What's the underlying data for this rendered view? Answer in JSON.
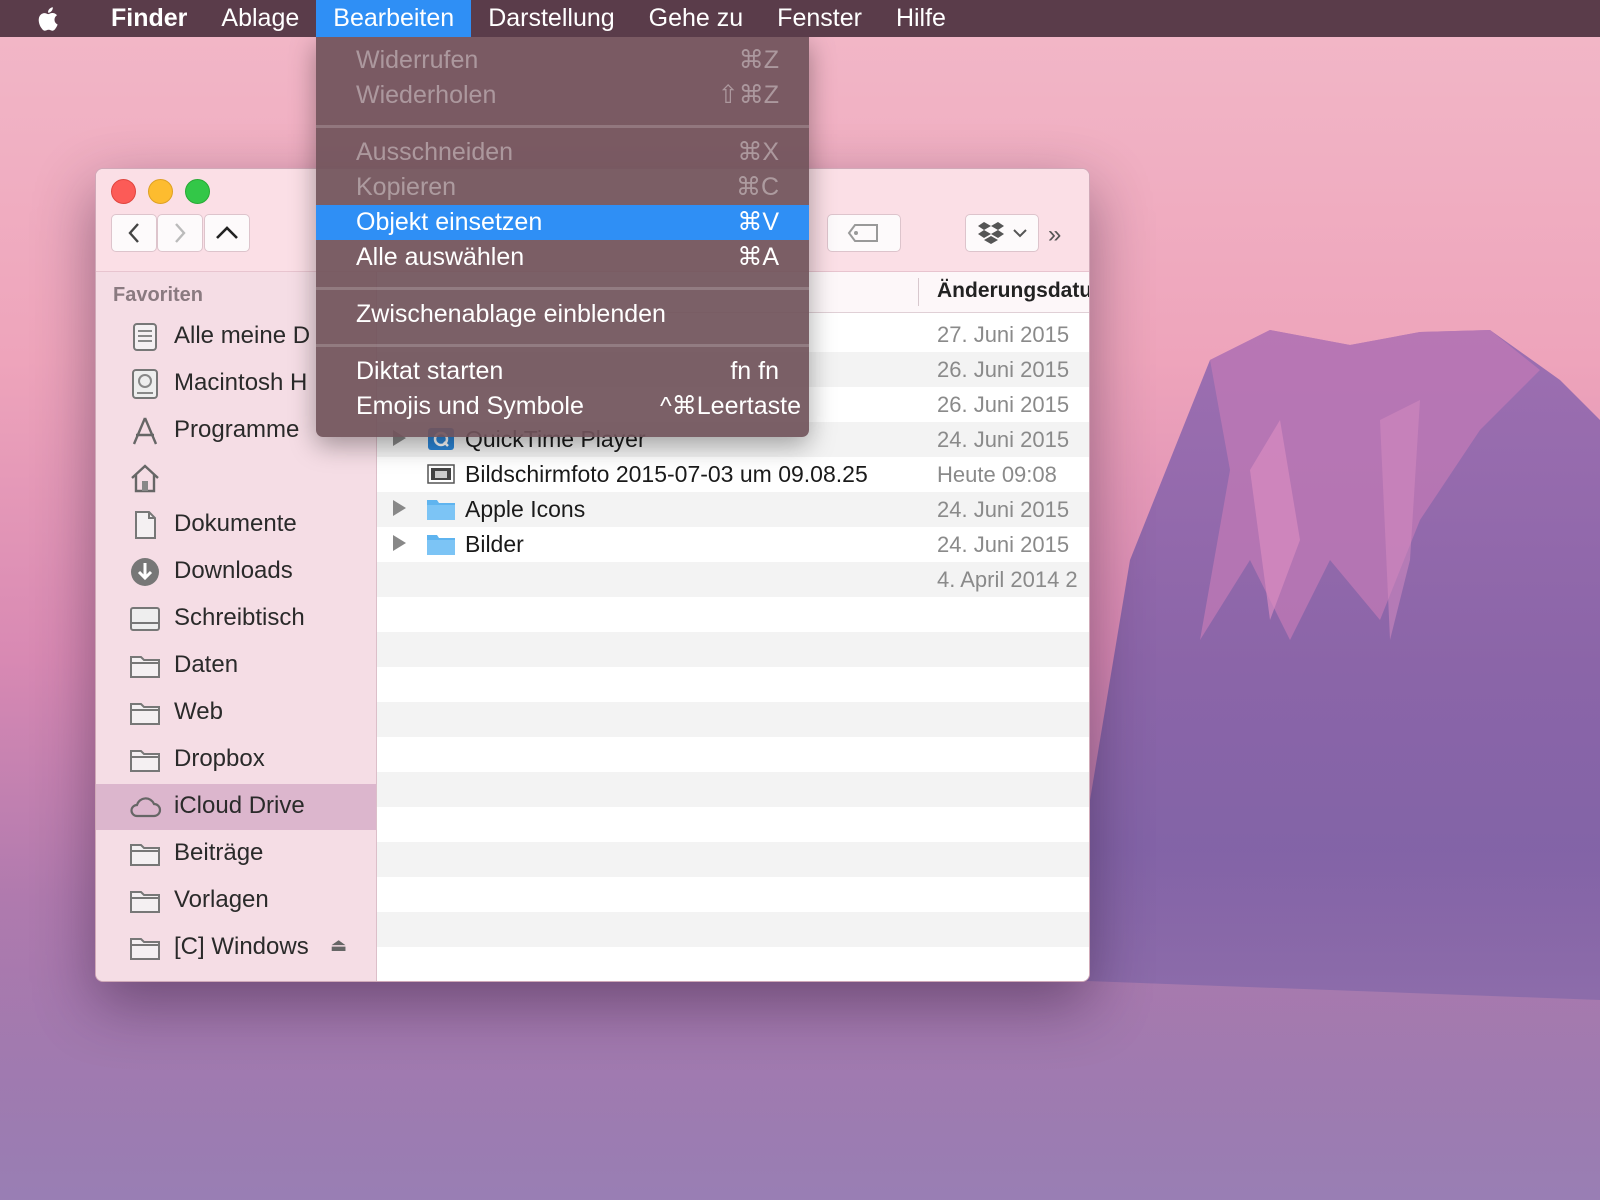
{
  "menubar": {
    "items": [
      {
        "label": "Finder"
      },
      {
        "label": "Ablage"
      },
      {
        "label": "Bearbeiten"
      },
      {
        "label": "Darstellung"
      },
      {
        "label": "Gehe zu"
      },
      {
        "label": "Fenster"
      },
      {
        "label": "Hilfe"
      }
    ],
    "active_item": "Bearbeiten"
  },
  "edit_menu": {
    "items": [
      {
        "label": "Widerrufen",
        "shortcut": "⌘Z",
        "enabled": false
      },
      {
        "label": "Wiederholen",
        "shortcut": "⇧⌘Z",
        "enabled": false
      },
      {
        "label": "Ausschneiden",
        "shortcut": "⌘X",
        "enabled": false
      },
      {
        "label": "Kopieren",
        "shortcut": "⌘C",
        "enabled": false
      },
      {
        "label": "Objekt einsetzen",
        "shortcut": "⌘V",
        "enabled": true,
        "highlighted": true
      },
      {
        "label": "Alle auswählen",
        "shortcut": "⌘A",
        "enabled": true
      },
      {
        "label": "Zwischenablage einblenden",
        "shortcut": "",
        "enabled": true
      },
      {
        "label": "Diktat starten",
        "shortcut": "fn fn",
        "enabled": true
      },
      {
        "label": "Emojis und Symbole",
        "shortcut": "^⌘Leertaste",
        "enabled": true
      }
    ]
  },
  "sidebar": {
    "heading": "Favoriten",
    "items": [
      {
        "label": "Alle meine D",
        "icon": "all-files-icon"
      },
      {
        "label": "Macintosh H",
        "icon": "hard-drive-icon"
      },
      {
        "label": "Programme",
        "icon": "applications-icon"
      },
      {
        "label": "",
        "icon": "home-icon"
      },
      {
        "label": "Dokumente",
        "icon": "documents-icon"
      },
      {
        "label": "Downloads",
        "icon": "downloads-icon"
      },
      {
        "label": "Schreibtisch",
        "icon": "desktop-icon"
      },
      {
        "label": "Daten",
        "icon": "folder-icon"
      },
      {
        "label": "Web",
        "icon": "folder-icon"
      },
      {
        "label": "Dropbox",
        "icon": "folder-icon"
      },
      {
        "label": "iCloud Drive",
        "icon": "cloud-icon",
        "selected": true
      },
      {
        "label": "Beiträge",
        "icon": "folder-icon"
      },
      {
        "label": "Vorlagen",
        "icon": "folder-icon"
      },
      {
        "label": "[C] Windows",
        "icon": "folder-icon",
        "eject": "⏏"
      }
    ]
  },
  "content": {
    "column_header": "Änderungsdatu",
    "rows": [
      {
        "name": "",
        "date": "27. Juni 2015",
        "expandable": false,
        "icon": ""
      },
      {
        "name": "",
        "date": "26. Juni 2015",
        "expandable": false,
        "icon": ""
      },
      {
        "name": "",
        "date": "26. Juni 2015",
        "expandable": false,
        "icon": ""
      },
      {
        "name": "QuickTime Player",
        "date": "24. Juni 2015",
        "expandable": true,
        "icon": "quicktime-icon"
      },
      {
        "name": "Bildschirmfoto 2015-07-03 um 09.08.25",
        "date": "Heute 09:08",
        "expandable": false,
        "icon": "screenshot-icon"
      },
      {
        "name": "Apple Icons",
        "date": "24. Juni 2015",
        "expandable": true,
        "icon": "folder-icon"
      },
      {
        "name": "Bilder",
        "date": "24. Juni 2015",
        "expandable": true,
        "icon": "folder-icon"
      },
      {
        "name": "",
        "date": "4. April 2014 2",
        "expandable": false,
        "icon": ""
      }
    ]
  },
  "colors": {
    "accent": "#2f8ff5",
    "menubar": "#5a3c4a",
    "close": "#fc5b57",
    "minimize": "#fdbc2f",
    "zoom": "#33c748"
  }
}
